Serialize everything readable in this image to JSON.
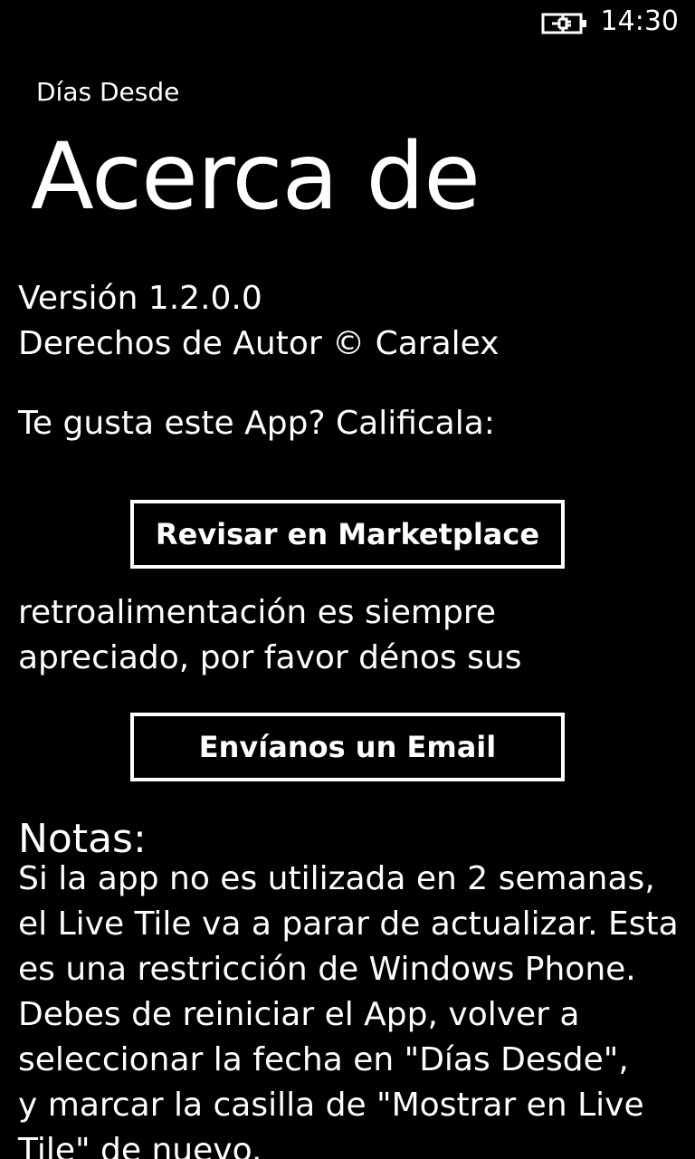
{
  "status_bar": {
    "time": "14:30",
    "battery_icon": "battery-charging-icon"
  },
  "header": {
    "app_name": "Días Desde",
    "page_title": "Acerca de"
  },
  "about": {
    "version": "Versión 1.2.0.0",
    "copyright": "Derechos de Autor © Caralex",
    "rate_prompt": "Te gusta este App? Calificala:",
    "marketplace_button": "Revisar en Marketplace",
    "feedback_lines": [
      "retroalimentación es siempre",
      "apreciado, por favor dénos sus"
    ],
    "email_button": "Envíanos un Email"
  },
  "notes": {
    "heading": "Notas:",
    "lines": [
      "Si la app no es utilizada en 2 semanas,",
      "el Live Tile va a parar de actualizar. Esta",
      "es una restricción de Windows Phone.",
      "Debes de reiniciar el App, volver a",
      "seleccionar la fecha en \"Días Desde\",",
      "y marcar la casilla  de \"Mostrar en Live",
      "Tile\" de nuevo."
    ]
  }
}
